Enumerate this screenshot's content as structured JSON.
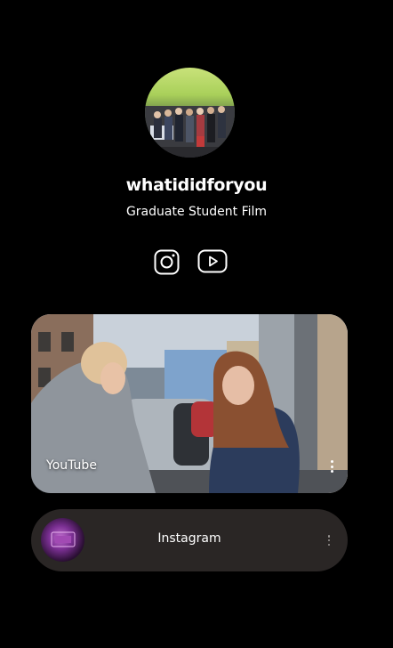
{
  "profile": {
    "username": "whatididforyou",
    "bio": "Graduate Student Film"
  },
  "social_icons": [
    {
      "icon": "instagram-icon"
    },
    {
      "icon": "youtube-icon"
    }
  ],
  "links": [
    {
      "title": "YouTube",
      "style": "featured-video"
    },
    {
      "title": "Instagram",
      "style": "thumbnail"
    }
  ],
  "colors": {
    "background": "#000000",
    "card_background": "#2a2625",
    "text": "#ffffff"
  }
}
